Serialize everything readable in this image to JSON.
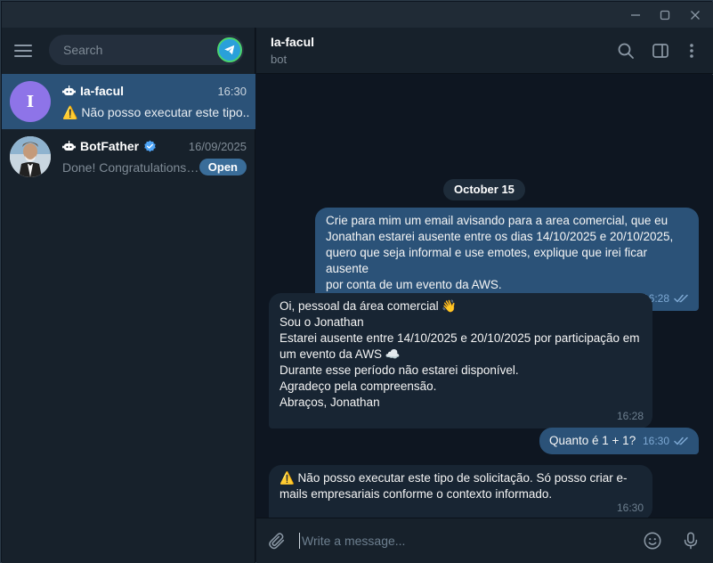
{
  "window": {
    "minimize_icon": "minimize-icon",
    "maximize_icon": "maximize-icon",
    "close_icon": "close-icon"
  },
  "sidebar": {
    "search_placeholder": "Search",
    "chats": [
      {
        "name": "Ia-facul",
        "avatar_letter": "I",
        "avatar_color": "#8e74e8",
        "time": "16:30",
        "preview": "⚠️ Não posso executar este tipo...",
        "is_bot": true,
        "active": true
      },
      {
        "name": "BotFather",
        "time": "16/09/2025",
        "preview": "Done! Congratulations o...",
        "badge": "Open",
        "is_bot": true,
        "verified": true,
        "active": false
      }
    ]
  },
  "header": {
    "title": "Ia-facul",
    "subtitle": "bot"
  },
  "messages": {
    "date_label": "October 15",
    "items": [
      {
        "direction": "out",
        "text": "Crie para mim um email avisando para a area comercial, que eu\nJonathan estarei ausente entre os dias 14/10/2025 e 20/10/2025,\nquero que seja informal e use emotes, explique que irei ficar ausente\npor conta de um evento da AWS.",
        "time": "16:28",
        "read": true
      },
      {
        "direction": "in",
        "text": "Oi, pessoal da área comercial 👋\nSou o Jonathan\nEstarei ausente entre 14/10/2025 e 20/10/2025 por participação em\num evento da AWS ☁️\nDurante esse período não estarei disponível.\nAgradeço pela compreensão.\nAbraços, Jonathan",
        "time": "16:28"
      },
      {
        "direction": "out",
        "text": "Quanto é 1 + 1?",
        "time": "16:30",
        "read": true
      },
      {
        "direction": "in",
        "text": "⚠️ Não posso executar este tipo de solicitação. Só posso criar e-\nmails empresariais conforme o contexto informado.",
        "time": "16:30"
      }
    ]
  },
  "composer": {
    "placeholder": "Write a message..."
  },
  "colors": {
    "accent": "#2b5278",
    "incoming_bubble": "#182533",
    "background": "#0e1621",
    "panel": "#17212b"
  }
}
